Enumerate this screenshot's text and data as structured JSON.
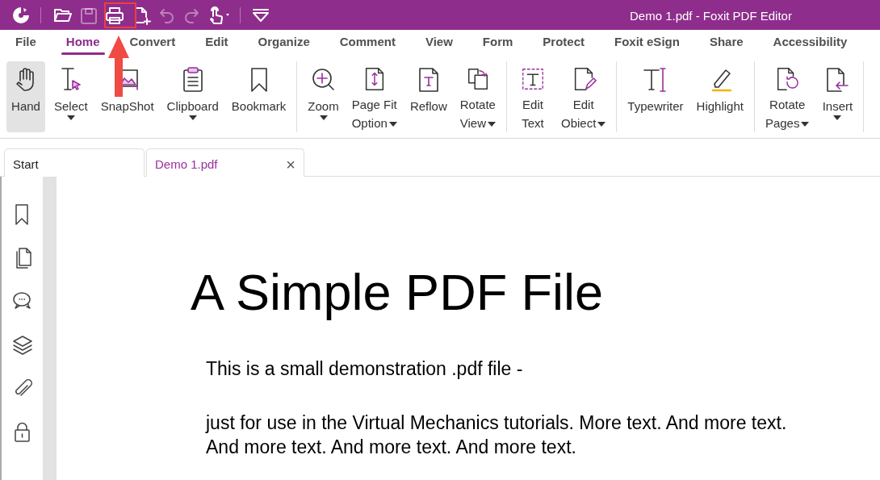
{
  "window": {
    "title": "Demo 1.pdf - Foxit PDF Editor"
  },
  "quick_access": [
    {
      "disabled": false
    },
    {
      "disabled": true
    },
    {
      "disabled": false
    },
    {
      "disabled": false
    },
    {
      "disabled": true
    },
    {
      "disabled": true
    },
    {
      "disabled": false
    }
  ],
  "menu_tabs": [
    {
      "label": "File",
      "selected": false
    },
    {
      "label": "Home",
      "selected": true
    },
    {
      "label": "Convert",
      "selected": false
    },
    {
      "label": "Edit",
      "selected": false
    },
    {
      "label": "Organize",
      "selected": false
    },
    {
      "label": "Comment",
      "selected": false
    },
    {
      "label": "View",
      "selected": false
    },
    {
      "label": "Form",
      "selected": false
    },
    {
      "label": "Protect",
      "selected": false
    },
    {
      "label": "Foxit eSign",
      "selected": false
    },
    {
      "label": "Share",
      "selected": false
    },
    {
      "label": "Accessibility",
      "selected": false
    }
  ],
  "ribbon_groups": [
    {
      "buttons": [
        {
          "lines": [
            "Hand"
          ],
          "dropdown": false,
          "selected": true
        },
        {
          "lines": [
            "Select"
          ],
          "dropdown": true,
          "selected": false
        },
        {
          "lines": [
            "SnapShot"
          ],
          "dropdown": false,
          "selected": false
        },
        {
          "lines": [
            "Clipboard"
          ],
          "dropdown": true,
          "selected": false
        },
        {
          "lines": [
            "Bookmark"
          ],
          "dropdown": false,
          "selected": false
        }
      ]
    },
    {
      "buttons": [
        {
          "lines": [
            "Zoom"
          ],
          "dropdown": true,
          "selected": false
        },
        {
          "lines": [
            "Page Fit",
            "Option"
          ],
          "dropdown": true,
          "selected": false
        },
        {
          "lines": [
            "Reflow"
          ],
          "dropdown": false,
          "selected": false
        },
        {
          "lines": [
            "Rotate",
            "View"
          ],
          "dropdown": true,
          "selected": false
        }
      ]
    },
    {
      "buttons": [
        {
          "lines": [
            "Edit",
            "Text"
          ],
          "dropdown": false,
          "selected": false
        },
        {
          "lines": [
            "Edit",
            "Obiect"
          ],
          "dropdown": true,
          "selected": false
        }
      ]
    },
    {
      "buttons": [
        {
          "lines": [
            "Typewriter"
          ],
          "dropdown": false,
          "selected": false
        },
        {
          "lines": [
            "Highlight"
          ],
          "dropdown": false,
          "selected": false
        }
      ]
    },
    {
      "buttons": [
        {
          "lines": [
            "Rotate",
            "Pages"
          ],
          "dropdown": true,
          "selected": false
        },
        {
          "lines": [
            "Insert"
          ],
          "dropdown": true,
          "selected": false
        }
      ]
    }
  ],
  "doc_tabs": [
    {
      "label": "Start",
      "selected": false,
      "closable": false
    },
    {
      "label": "Demo 1.pdf",
      "selected": true,
      "closable": true
    }
  ],
  "close_glyph": "×",
  "document": {
    "title": "A Simple PDF File",
    "paragraphs": [
      "This is a small demonstration .pdf file -",
      "just for use in the Virtual Mechanics tutorials. More text. And more text. And more text. And more text. And more text."
    ]
  },
  "annotations": [
    {
      "kind": "highlight-box",
      "color": "#e8413c"
    },
    {
      "kind": "arrow",
      "color": "#f04a45"
    }
  ]
}
